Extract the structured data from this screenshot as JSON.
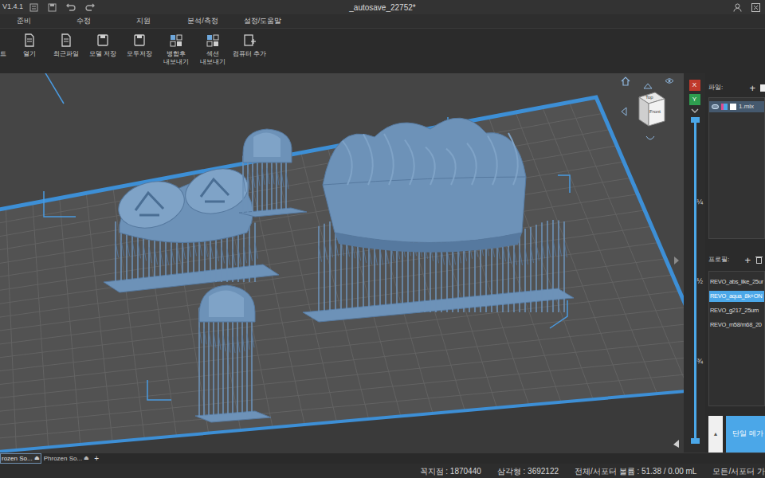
{
  "window": {
    "version": "V1.4.1",
    "title": "_autosave_22752*"
  },
  "menu": [
    {
      "label": "준비"
    },
    {
      "label": "수정"
    },
    {
      "label": "지원"
    },
    {
      "label": "분석/측정"
    },
    {
      "label": "설정/도움말"
    }
  ],
  "toolbar": [
    {
      "label": "트"
    },
    {
      "label": "열기"
    },
    {
      "label": "최근파일"
    },
    {
      "label": "모델 저장"
    },
    {
      "label": "모두저장"
    },
    {
      "label": "병합후\n내보내기"
    },
    {
      "label": "섹션\n내보내기"
    },
    {
      "label": "컴퓨터 추가"
    }
  ],
  "view_cube": {
    "top": "Top",
    "front": "Front"
  },
  "axis_buttons": [
    {
      "label": "X",
      "color": "#c0392b"
    },
    {
      "label": "Y",
      "color": "#2e9e4f"
    }
  ],
  "layer_slider": {
    "ticks": [
      "¼",
      "½",
      "¾"
    ],
    "level": 1
  },
  "files": {
    "label": "파일:",
    "add": "+",
    "items": [
      {
        "name": "1.mix",
        "visible": true,
        "selected": true
      }
    ]
  },
  "profiles": {
    "label": "프로필:",
    "add": "+",
    "items": [
      {
        "name": "REVO_abs_like_25ur",
        "selected": false
      },
      {
        "name": "REVO_aqua_8k+ON",
        "selected": true
      },
      {
        "name": "REVO_g217_25um",
        "selected": false
      },
      {
        "name": "REVO_m58/m68_20",
        "selected": false
      }
    ]
  },
  "up_button": "▲",
  "slice_button": "단일 메가",
  "tabs": [
    {
      "label": "rozen So...",
      "eject": "⏏",
      "selected": true
    },
    {
      "label": "Phrozen So...",
      "eject": "⏏",
      "selected": false
    }
  ],
  "tab_add": "+",
  "status_bar": [
    "꼭지점 : 1870440",
    "삼각형 : 3692122",
    "전체/서포터 볼륨 : 51.38 / 0.00 mL",
    "모든/서포터 가"
  ]
}
